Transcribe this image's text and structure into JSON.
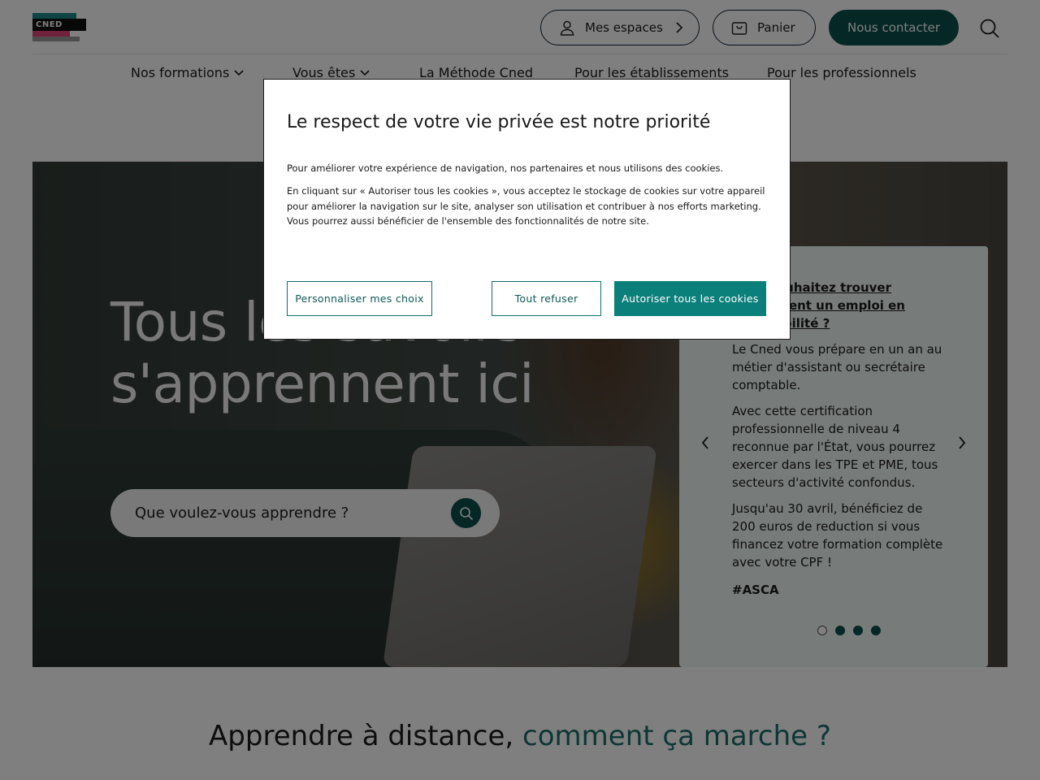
{
  "header": {
    "logo_text": "CNED",
    "espaces_label": "Mes espaces",
    "panier_label": "Panier",
    "contact_label": "Nous contacter"
  },
  "nav": {
    "items": [
      {
        "label": "Nos formations"
      },
      {
        "label": "Vous êtes"
      },
      {
        "label": "La Méthode Cned"
      },
      {
        "label": "Pour les établissements"
      },
      {
        "label": "Pour les professionnels"
      }
    ]
  },
  "hero": {
    "title_line1": "Tous les savoirs",
    "title_line2": "s'apprennent ici",
    "search_placeholder": "Que voulez-vous apprendre ?"
  },
  "carousel": {
    "heading": "Vous souhaitez trouver rapidement un emploi en comptabilité ?",
    "p1": "Le Cned vous prépare en un an au métier d'assistant ou secrétaire comptable.",
    "p2": "Avec cette certification professionnelle de niveau 4 reconnue par l'État, vous pourrez exercer dans les TPE et PME, tous secteurs d'activité confondus.",
    "p3": "Jusqu'au 30 avril, bénéficiez de 200 euros de reduction si vous financez votre formation complète avec votre CPF !",
    "tag": "#ASCA",
    "active_slide": 1,
    "slide_count": 4
  },
  "section": {
    "title_plain": "Apprendre à distance, ",
    "title_accent": "comment ça marche ?"
  },
  "cookie_modal": {
    "title": "Le respect de votre vie privée est notre priorité",
    "p1": "Pour améliorer votre expérience de navigation, nos partenaires et nous utilisons des cookies.",
    "p2": "En cliquant sur « Autoriser tous les cookies », vous acceptez le stockage de cookies sur votre appareil pour améliorer la navigation sur le site, analyser son utilisation et contribuer à nos efforts marketing. Vous pourrez aussi bénéficier de l'ensemble des fonctionnalités de notre site.",
    "customize_label": "Personnaliser mes choix",
    "refuse_label": "Tout refuser",
    "accept_label": "Autoriser tous les cookies"
  },
  "colors": {
    "brand_teal": "#0b4f4c",
    "accent_teal": "#1a6e6a",
    "logo_pink": "#e0457b"
  },
  "icons": [
    "user-icon",
    "chevron-right-icon",
    "basket-icon",
    "search-icon",
    "chevron-down-icon",
    "arrow-left-icon",
    "arrow-right-icon"
  ]
}
